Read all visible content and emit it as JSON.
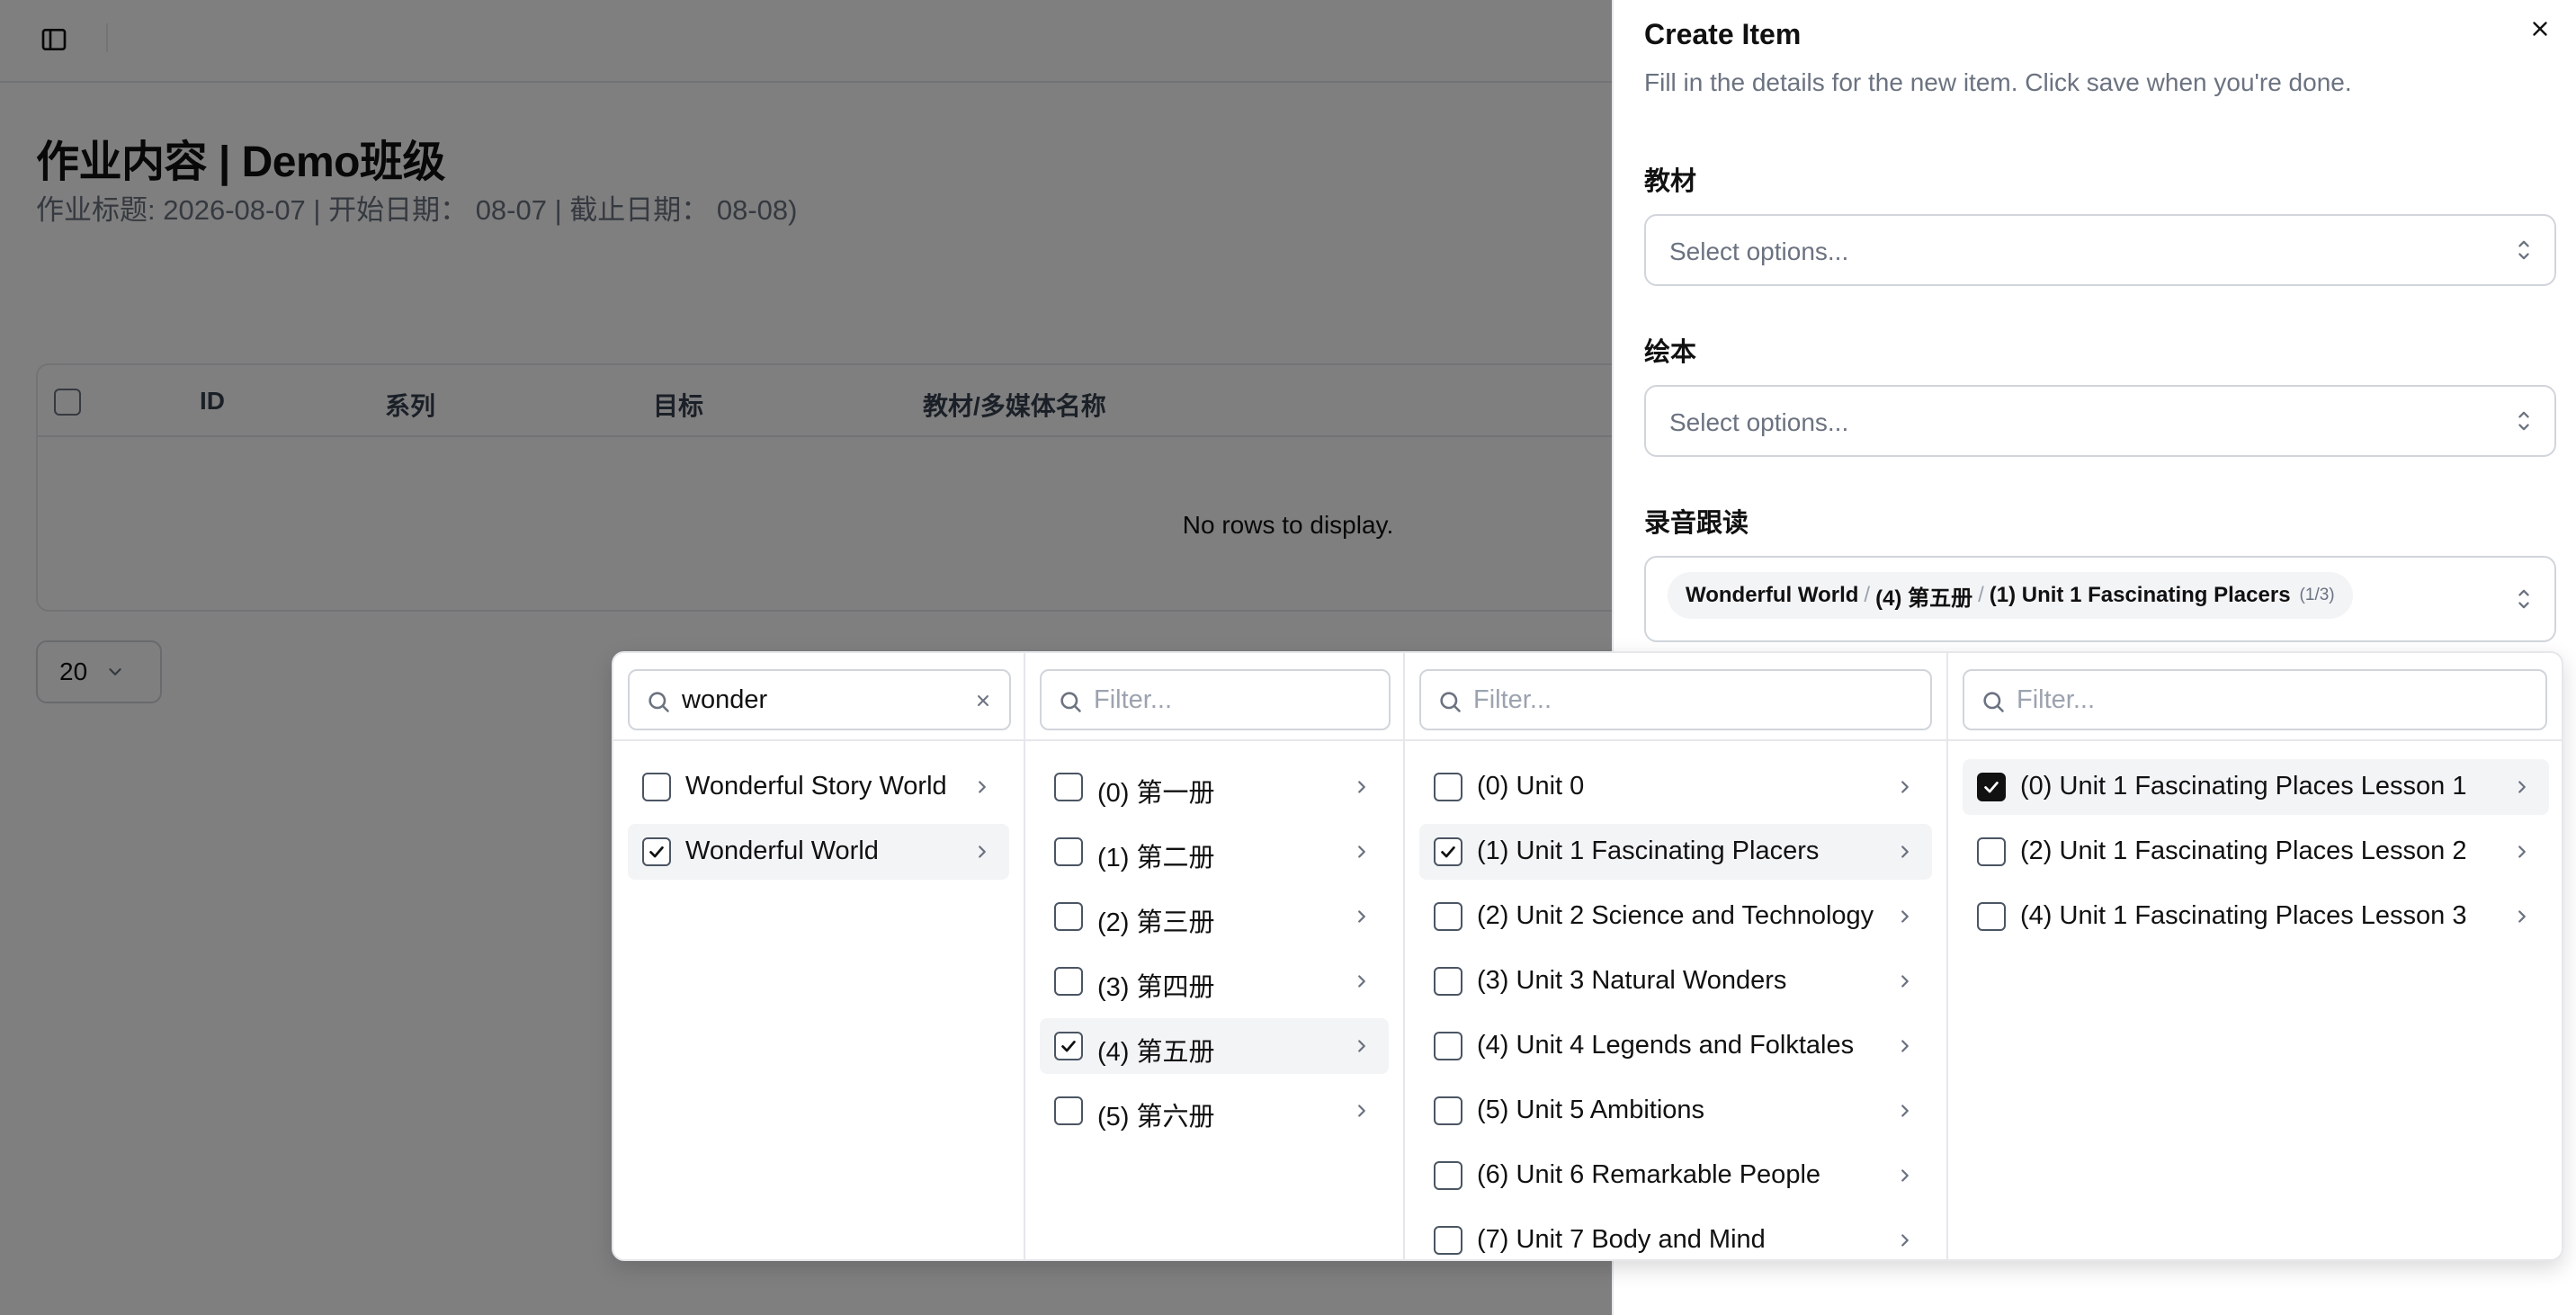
{
  "page": {
    "title": "作业内容 | Demo班级",
    "subtitle": "作业标题: 2026-08-07 | 开始日期： 08-07 | 截止日期： 08-08)",
    "table": {
      "columns": [
        "ID",
        "系列",
        "目标",
        "教材/多媒体名称"
      ],
      "empty_text": "No rows to display."
    },
    "page_size": "20"
  },
  "sheet": {
    "title": "Create Item",
    "description": "Fill in the details for the new item. Click save when you're done.",
    "fields": [
      {
        "label": "教材",
        "placeholder": "Select options..."
      },
      {
        "label": "绘本",
        "placeholder": "Select options..."
      },
      {
        "label": "录音跟读"
      }
    ],
    "selected_chip": {
      "parts": [
        "Wonderful World",
        "(4) 第五册",
        "(1) Unit 1 Fascinating Placers"
      ],
      "count": "(1/3)"
    }
  },
  "cascader": {
    "columns": [
      {
        "filter_value": "wonder",
        "filter_placeholder": "Filter...",
        "items": [
          {
            "label": "Wonderful Story World",
            "checked": false,
            "selected": false
          },
          {
            "label": "Wonderful World",
            "checked": true,
            "selected": true
          }
        ]
      },
      {
        "filter_value": "",
        "filter_placeholder": "Filter...",
        "items": [
          {
            "label": "(0) 第一册",
            "checked": false,
            "selected": false
          },
          {
            "label": "(1) 第二册",
            "checked": false,
            "selected": false
          },
          {
            "label": "(2) 第三册",
            "checked": false,
            "selected": false
          },
          {
            "label": "(3) 第四册",
            "checked": false,
            "selected": false
          },
          {
            "label": "(4) 第五册",
            "checked": true,
            "selected": true
          },
          {
            "label": "(5) 第六册",
            "checked": false,
            "selected": false
          }
        ]
      },
      {
        "filter_value": "",
        "filter_placeholder": "Filter...",
        "items": [
          {
            "label": "(0) Unit 0",
            "checked": false,
            "selected": false
          },
          {
            "label": "(1) Unit 1 Fascinating Placers",
            "checked": true,
            "selected": true
          },
          {
            "label": "(2) Unit 2 Science and Technology",
            "checked": false,
            "selected": false
          },
          {
            "label": "(3) Unit 3 Natural Wonders",
            "checked": false,
            "selected": false
          },
          {
            "label": "(4) Unit 4 Legends and Folktales",
            "checked": false,
            "selected": false
          },
          {
            "label": "(5) Unit 5 Ambitions",
            "checked": false,
            "selected": false
          },
          {
            "label": "(6) Unit 6 Remarkable People",
            "checked": false,
            "selected": false
          },
          {
            "label": "(7) Unit 7 Body and Mind",
            "checked": false,
            "selected": false
          }
        ]
      },
      {
        "filter_value": "",
        "filter_placeholder": "Filter...",
        "items": [
          {
            "label": "(0) Unit 1 Fascinating Places Lesson 1",
            "checked": true,
            "selected": true,
            "filled": true
          },
          {
            "label": "(2) Unit 1 Fascinating Places Lesson 2",
            "checked": false,
            "selected": false
          },
          {
            "label": "(4) Unit 1 Fascinating Places Lesson 3",
            "checked": false,
            "selected": false
          }
        ]
      }
    ]
  },
  "icons": {
    "sidebar_toggle": "sidebar-toggle-icon",
    "close": "close-icon",
    "select_chevrons": "chevrons-up-down-icon",
    "search": "search-icon",
    "clear": "x-icon",
    "chevron_right": "chevron-right-icon",
    "check": "check-icon"
  }
}
